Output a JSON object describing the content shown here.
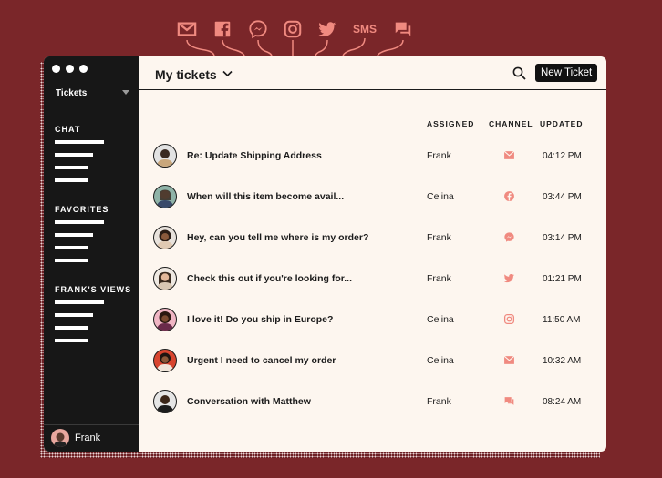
{
  "colors": {
    "background": "#7a2629",
    "accent": "#f08a80",
    "sidebar": "#171717",
    "panel": "#fdf6ef"
  },
  "channel_bar": [
    {
      "icon": "mail-icon"
    },
    {
      "icon": "facebook-icon"
    },
    {
      "icon": "messenger-icon"
    },
    {
      "icon": "instagram-icon"
    },
    {
      "icon": "twitter-icon"
    },
    {
      "icon": "sms-label",
      "label": "SMS"
    },
    {
      "icon": "chat-icon"
    }
  ],
  "sidebar": {
    "title": "Tickets",
    "sections": [
      "CHAT",
      "FAVORITES",
      "FRANK'S VIEWS"
    ],
    "user": "Frank"
  },
  "header": {
    "title": "My tickets",
    "new_ticket": "New Ticket"
  },
  "columns": {
    "assigned": "ASSIGNED",
    "channel": "CHANNEL",
    "updated": "UPDATED"
  },
  "tickets": [
    {
      "subject": "Re: Update Shipping Address",
      "assigned": "Frank",
      "channel": "mail-icon",
      "updated": "04:12 PM"
    },
    {
      "subject": "When will this item become avail...",
      "assigned": "Celina",
      "channel": "facebook-icon",
      "updated": "03:44 PM"
    },
    {
      "subject": "Hey, can you tell me where is my order?",
      "assigned": "Frank",
      "channel": "messenger-icon",
      "updated": "03:14 PM"
    },
    {
      "subject": "Check this out if you're looking for...",
      "assigned": "Frank",
      "channel": "twitter-icon",
      "updated": "01:21 PM"
    },
    {
      "subject": "I love it! Do you ship in Europe?",
      "assigned": "Celina",
      "channel": "instagram-icon",
      "updated": "11:50 AM"
    },
    {
      "subject": "Urgent I need to cancel my order",
      "assigned": "Celina",
      "channel": "mail-icon",
      "updated": "10:32 AM"
    },
    {
      "subject": "Conversation with Matthew",
      "assigned": "Frank",
      "channel": "chat-icon",
      "updated": "08:24 AM"
    }
  ]
}
